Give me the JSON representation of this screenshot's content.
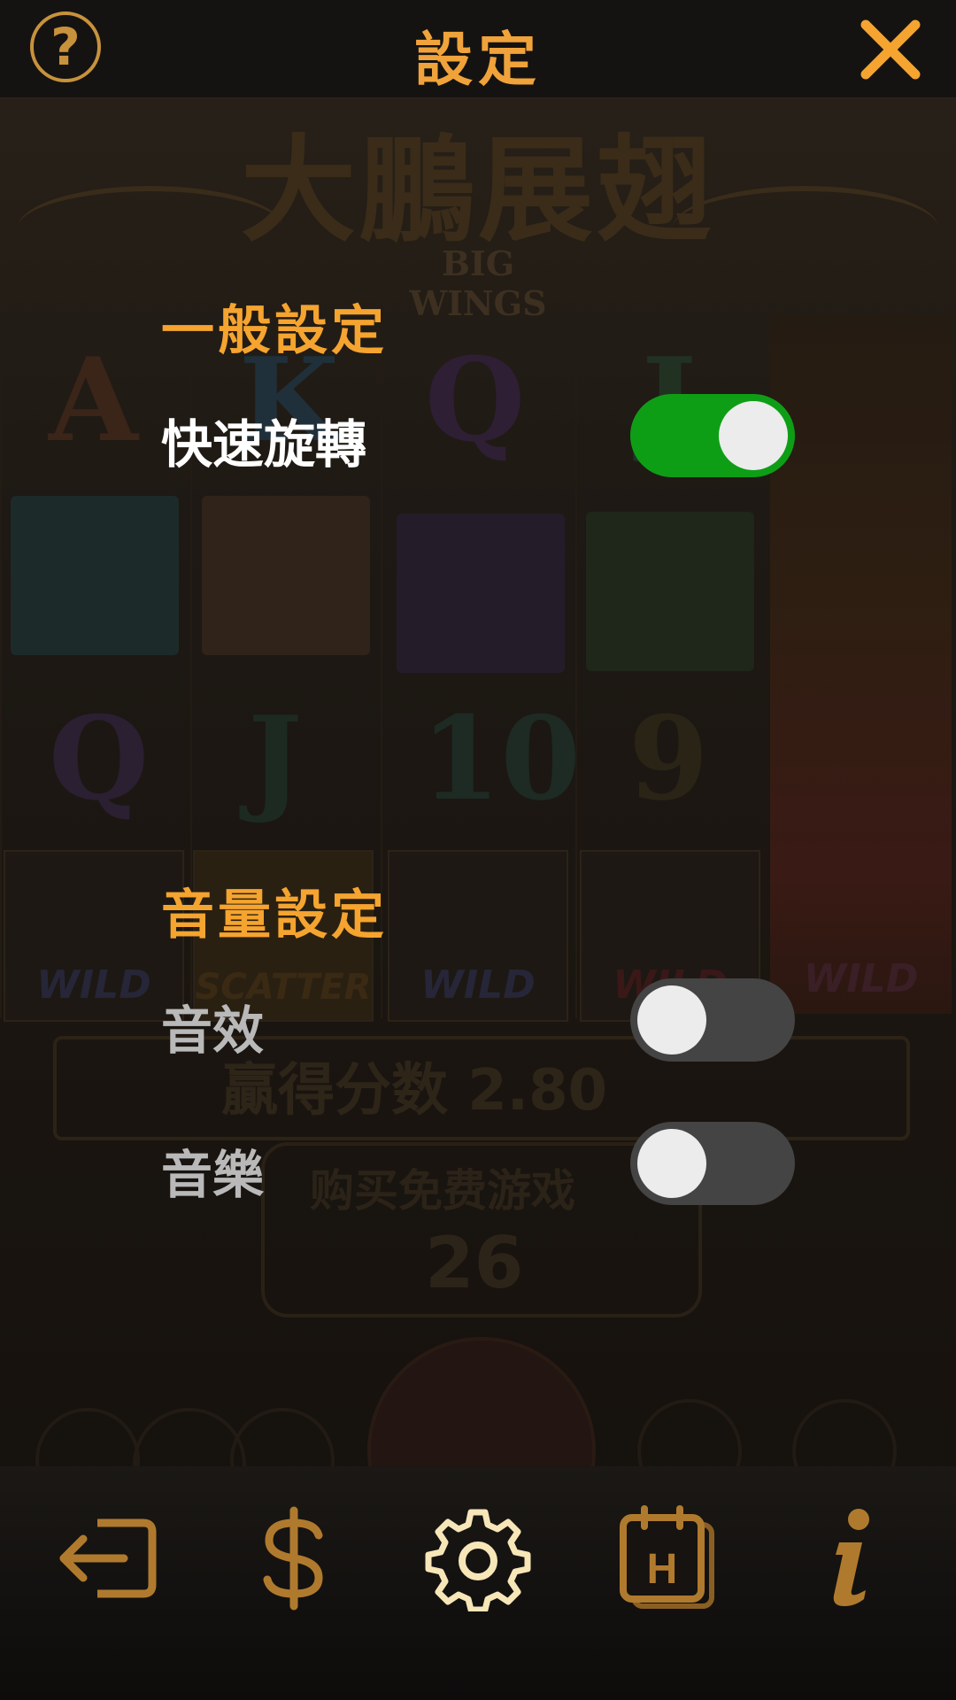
{
  "header": {
    "title": "設定",
    "help_glyph": "?",
    "help_icon": "question-circle-icon",
    "close_icon": "close-icon"
  },
  "general": {
    "section_title": "一般設定",
    "items": [
      {
        "label": "快速旋轉",
        "enabled": true
      }
    ]
  },
  "volume": {
    "section_title": "音量設定",
    "items": [
      {
        "label": "音效",
        "enabled": false
      },
      {
        "label": "音樂",
        "enabled": false
      }
    ]
  },
  "background": {
    "logo_text": "大鵬展翅",
    "logo_subtitle": "BIG WINGS",
    "symbols_row1": [
      "A",
      "K",
      "Q",
      "J"
    ],
    "symbols_row3": [
      "Q",
      "J",
      "10",
      "9"
    ],
    "wild_label": "WILD",
    "scatter_label": "SCATTER",
    "win_text": "贏得分数  2.80",
    "buy_text": "购买免费游戏",
    "buy_value": "26"
  },
  "bottom_nav": [
    {
      "icon": "exit-icon",
      "active": false
    },
    {
      "icon": "dollar-icon",
      "active": false
    },
    {
      "icon": "gear-icon",
      "active": true
    },
    {
      "icon": "history-calendar-icon",
      "active": false,
      "glyph": "H"
    },
    {
      "icon": "info-icon",
      "active": false
    }
  ],
  "colors": {
    "accent": "#f5a42f",
    "toggle_on": "#0e9e16",
    "toggle_off": "#444444",
    "nav_icon": "#b07a2e",
    "nav_icon_active": "#f6e6b8"
  }
}
